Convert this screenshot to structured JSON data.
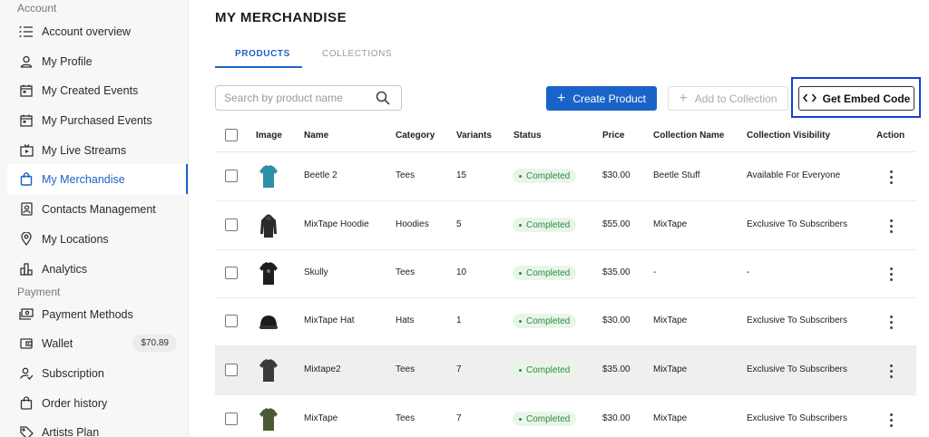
{
  "sidebar": {
    "section_account": "Account",
    "section_payment": "Payment",
    "items": [
      {
        "label": "Account overview"
      },
      {
        "label": "My Profile"
      },
      {
        "label": "My Created Events"
      },
      {
        "label": "My Purchased Events"
      },
      {
        "label": "My Live Streams"
      },
      {
        "label": "My Merchandise"
      },
      {
        "label": "Contacts Management"
      },
      {
        "label": "My Locations"
      },
      {
        "label": "Analytics"
      },
      {
        "label": "Payment Methods"
      },
      {
        "label": "Wallet",
        "badge": "$70.89"
      },
      {
        "label": "Subscription"
      },
      {
        "label": "Order history"
      },
      {
        "label": "Artists Plan"
      }
    ],
    "active_item": "My Merchandise"
  },
  "main": {
    "title": "MY MERCHANDISE",
    "tabs": [
      {
        "label": "PRODUCTS"
      },
      {
        "label": "COLLECTIONS"
      }
    ],
    "active_tab": "PRODUCTS",
    "search": {
      "placeholder": "Search by product name",
      "value": ""
    },
    "buttons": {
      "create": "Create Product",
      "add_to_collection": "Add to Collection",
      "embed": "Get Embed Code"
    }
  },
  "table": {
    "columns": [
      "Image",
      "Name",
      "Category",
      "Variants",
      "Status",
      "Price",
      "Collection Name",
      "Collection Visibility",
      "Action"
    ],
    "rows": [
      {
        "name": "Beetle 2",
        "category": "Tees",
        "variants": "15",
        "status": "Completed",
        "price": "$30.00",
        "collection": "Beetle Stuff",
        "visibility": "Available For Everyone",
        "image": "teal-tee"
      },
      {
        "name": "MixTape Hoodie",
        "category": "Hoodies",
        "variants": "5",
        "status": "Completed",
        "price": "$55.00",
        "collection": "MixTape",
        "visibility": "Exclusive To Subscribers",
        "image": "black-hoodie"
      },
      {
        "name": "Skully",
        "category": "Tees",
        "variants": "10",
        "status": "Completed",
        "price": "$35.00",
        "collection": "-",
        "visibility": "-",
        "image": "black-tee"
      },
      {
        "name": "MixTape Hat",
        "category": "Hats",
        "variants": "1",
        "status": "Completed",
        "price": "$30.00",
        "collection": "MixTape",
        "visibility": "Exclusive To Subscribers",
        "image": "black-hat"
      },
      {
        "name": "Mixtape2",
        "category": "Tees",
        "variants": "7",
        "status": "Completed",
        "price": "$35.00",
        "collection": "MixTape",
        "visibility": "Exclusive To Subscribers",
        "image": "dark-tee"
      },
      {
        "name": "MixTape",
        "category": "Tees",
        "variants": "7",
        "status": "Completed",
        "price": "$30.00",
        "collection": "MixTape",
        "visibility": "Exclusive To Subscribers",
        "image": "olive-tee"
      }
    ]
  },
  "colors": {
    "accent": "#1a63c8",
    "status_bg": "#eaf5ea",
    "status_text": "#2e8b3e",
    "highlight_frame": "#1a3fd1"
  }
}
